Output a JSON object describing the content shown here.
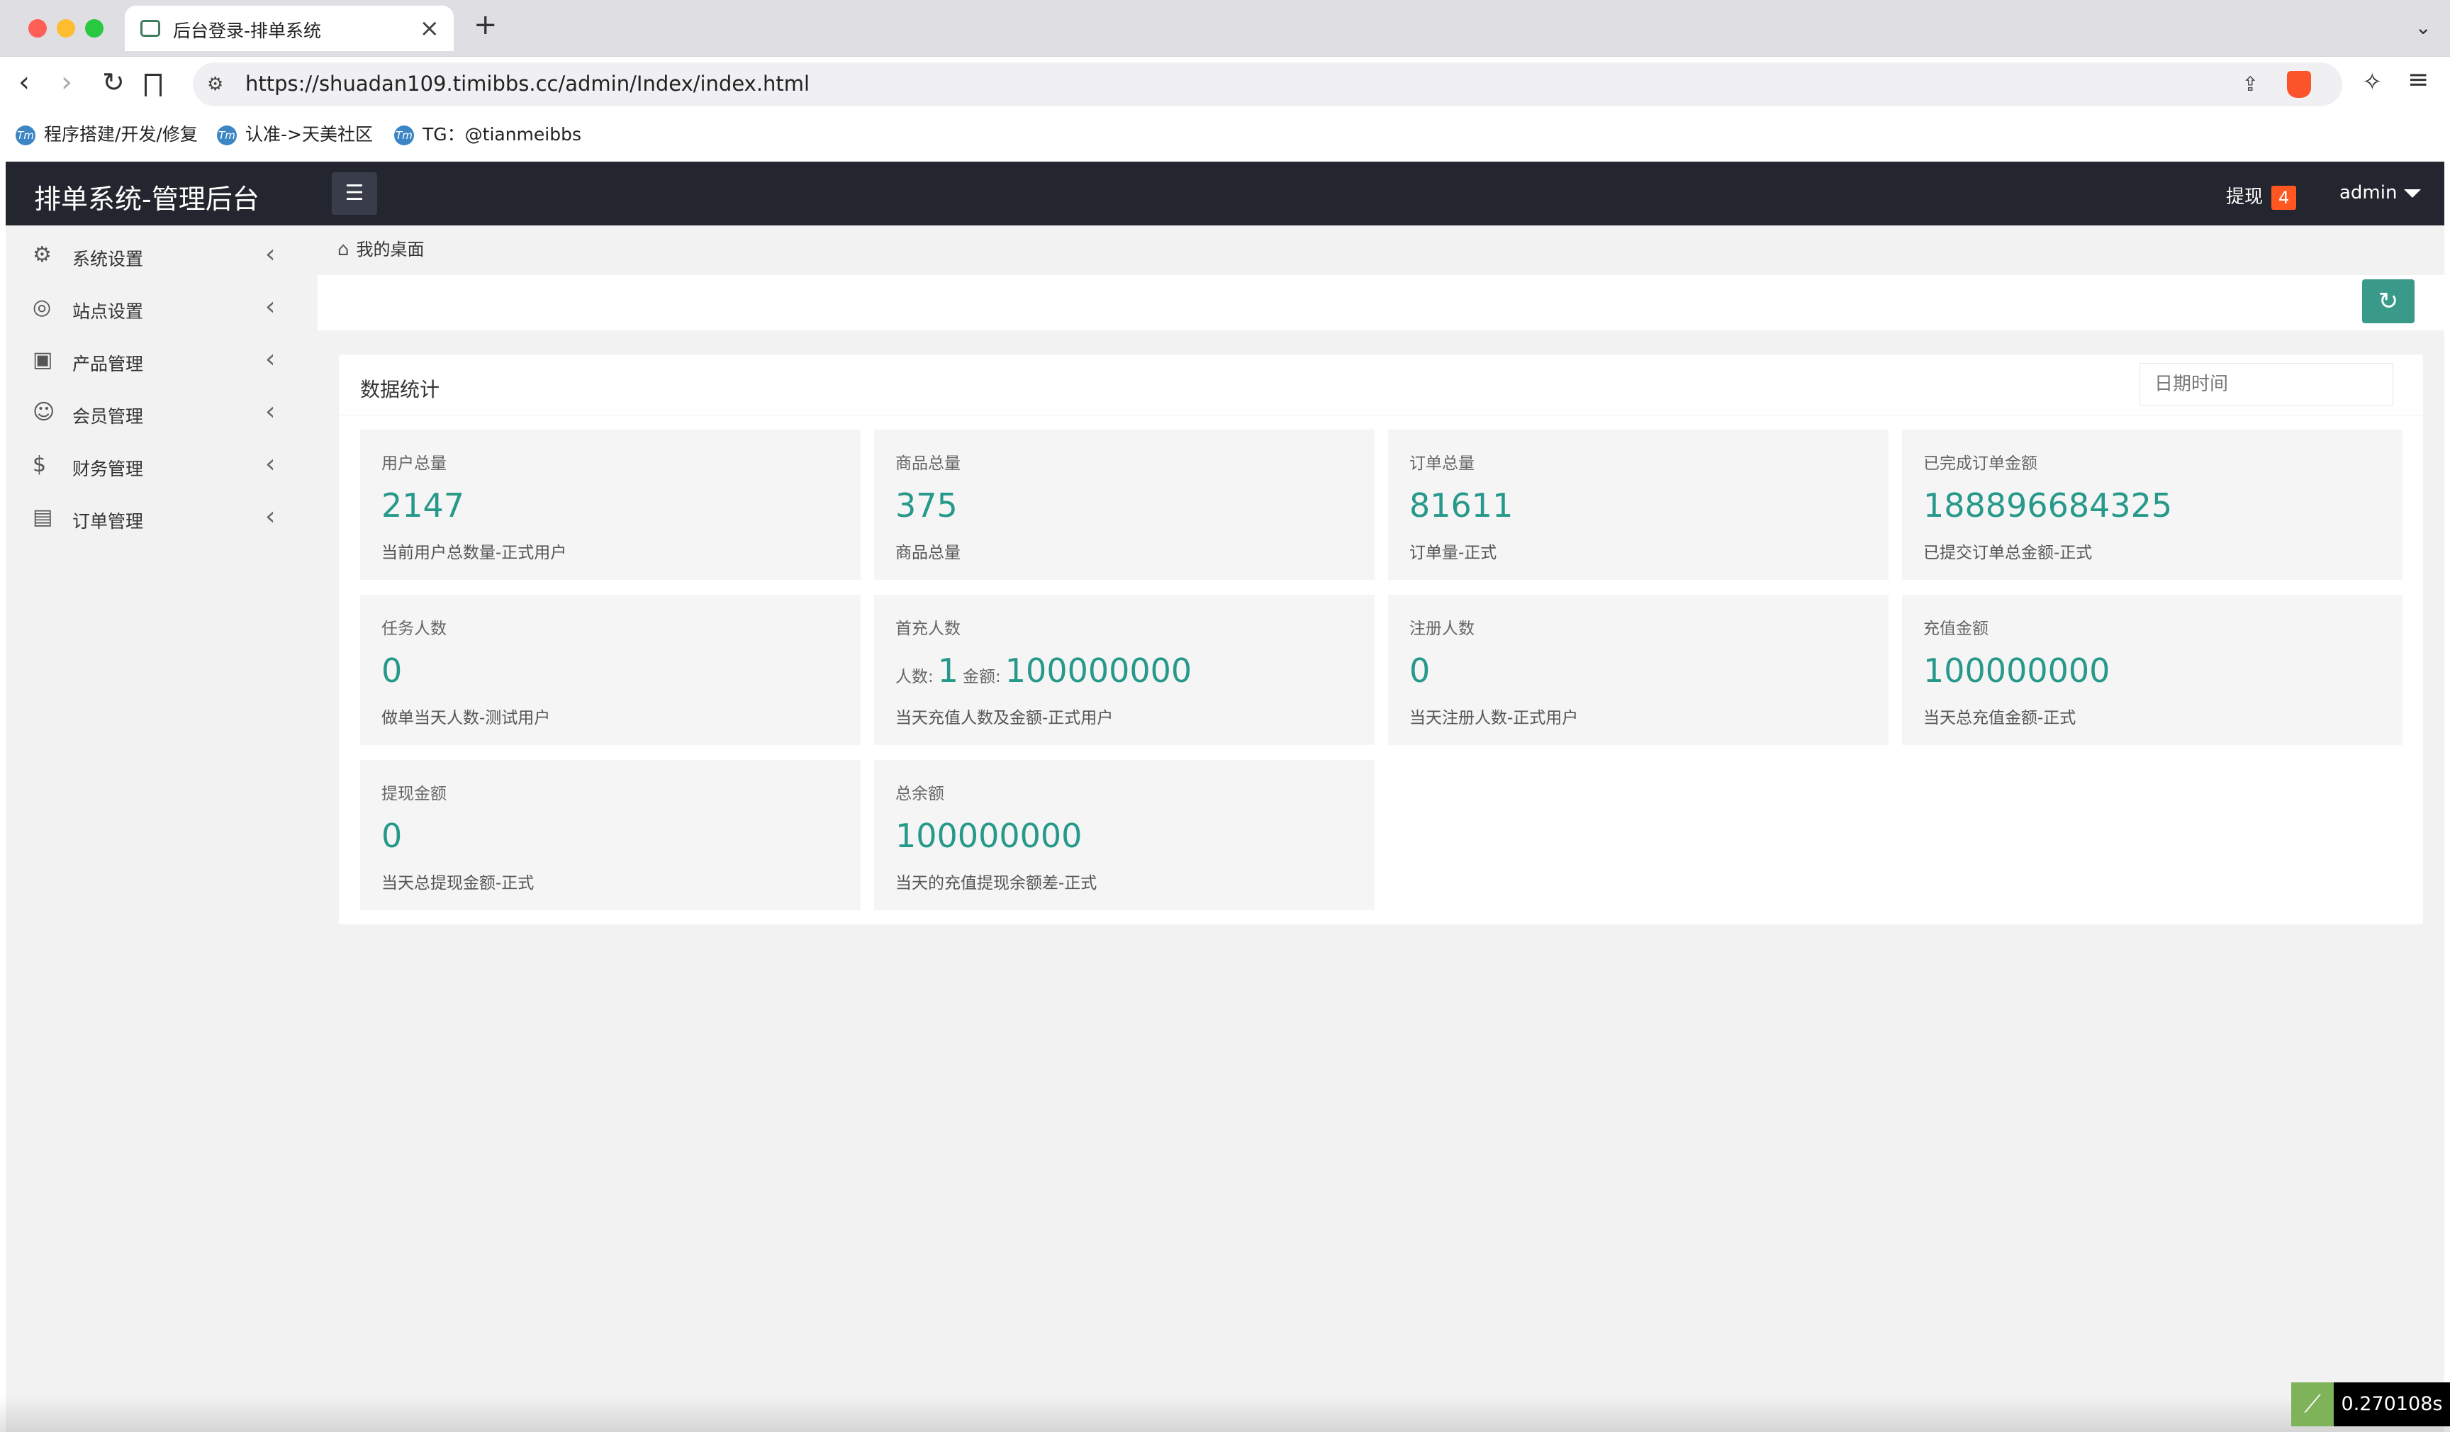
{
  "browser": {
    "tab_title": "后台登录-排单系统",
    "url": "https://shuadan109.timibbs.cc/admin/Index/index.html",
    "bookmarks": [
      "程序搭建/开发/修复",
      "认准->天美社区",
      "TG：@tianmeibbs"
    ]
  },
  "app": {
    "title": "排单系统-管理后台",
    "withdraw_label": "提现",
    "withdraw_count": "4",
    "user": "admin"
  },
  "sidebar": {
    "items": [
      {
        "label": "系统设置",
        "icon": "gear-icon"
      },
      {
        "label": "站点设置",
        "icon": "site-icon"
      },
      {
        "label": "产品管理",
        "icon": "box-icon"
      },
      {
        "label": "会员管理",
        "icon": "user-icon"
      },
      {
        "label": "财务管理",
        "icon": "dollar-icon"
      },
      {
        "label": "订单管理",
        "icon": "order-icon"
      }
    ]
  },
  "breadcrumb": "我的桌面",
  "stats_panel": {
    "title": "数据统计",
    "date_placeholder": "日期时间"
  },
  "stats": [
    {
      "title": "用户总量",
      "value": "2147",
      "desc": "当前用户总数量-正式用户"
    },
    {
      "title": "商品总量",
      "value": "375",
      "desc": "商品总量"
    },
    {
      "title": "订单总量",
      "value": "81611",
      "desc": "订单量-正式"
    },
    {
      "title": "已完成订单金额",
      "value": "188896684325",
      "desc": "已提交订单总金额-正式"
    },
    {
      "title": "任务人数",
      "value": "0",
      "desc": "做单当天人数-测试用户"
    },
    {
      "title": "首充人数",
      "count_label": "人数:",
      "count": "1",
      "amount_label": "金额:",
      "amount": "100000000",
      "desc": "当天充值人数及金额-正式用户"
    },
    {
      "title": "注册人数",
      "value": "0",
      "desc": "当天注册人数-正式用户"
    },
    {
      "title": "充值金额",
      "value": "100000000",
      "desc": "当天总充值金额-正式"
    },
    {
      "title": "提现金额",
      "value": "0",
      "desc": "当天总提现金额-正式"
    },
    {
      "title": "总余额",
      "value": "100000000",
      "desc": "当天的充值提现余额差-正式"
    }
  ],
  "overlay": {
    "timer": "0.270108s"
  },
  "colors": {
    "accent": "#26998a",
    "topbar": "#23262e",
    "badge": "#ff5722",
    "button": "#3a9a8a"
  }
}
